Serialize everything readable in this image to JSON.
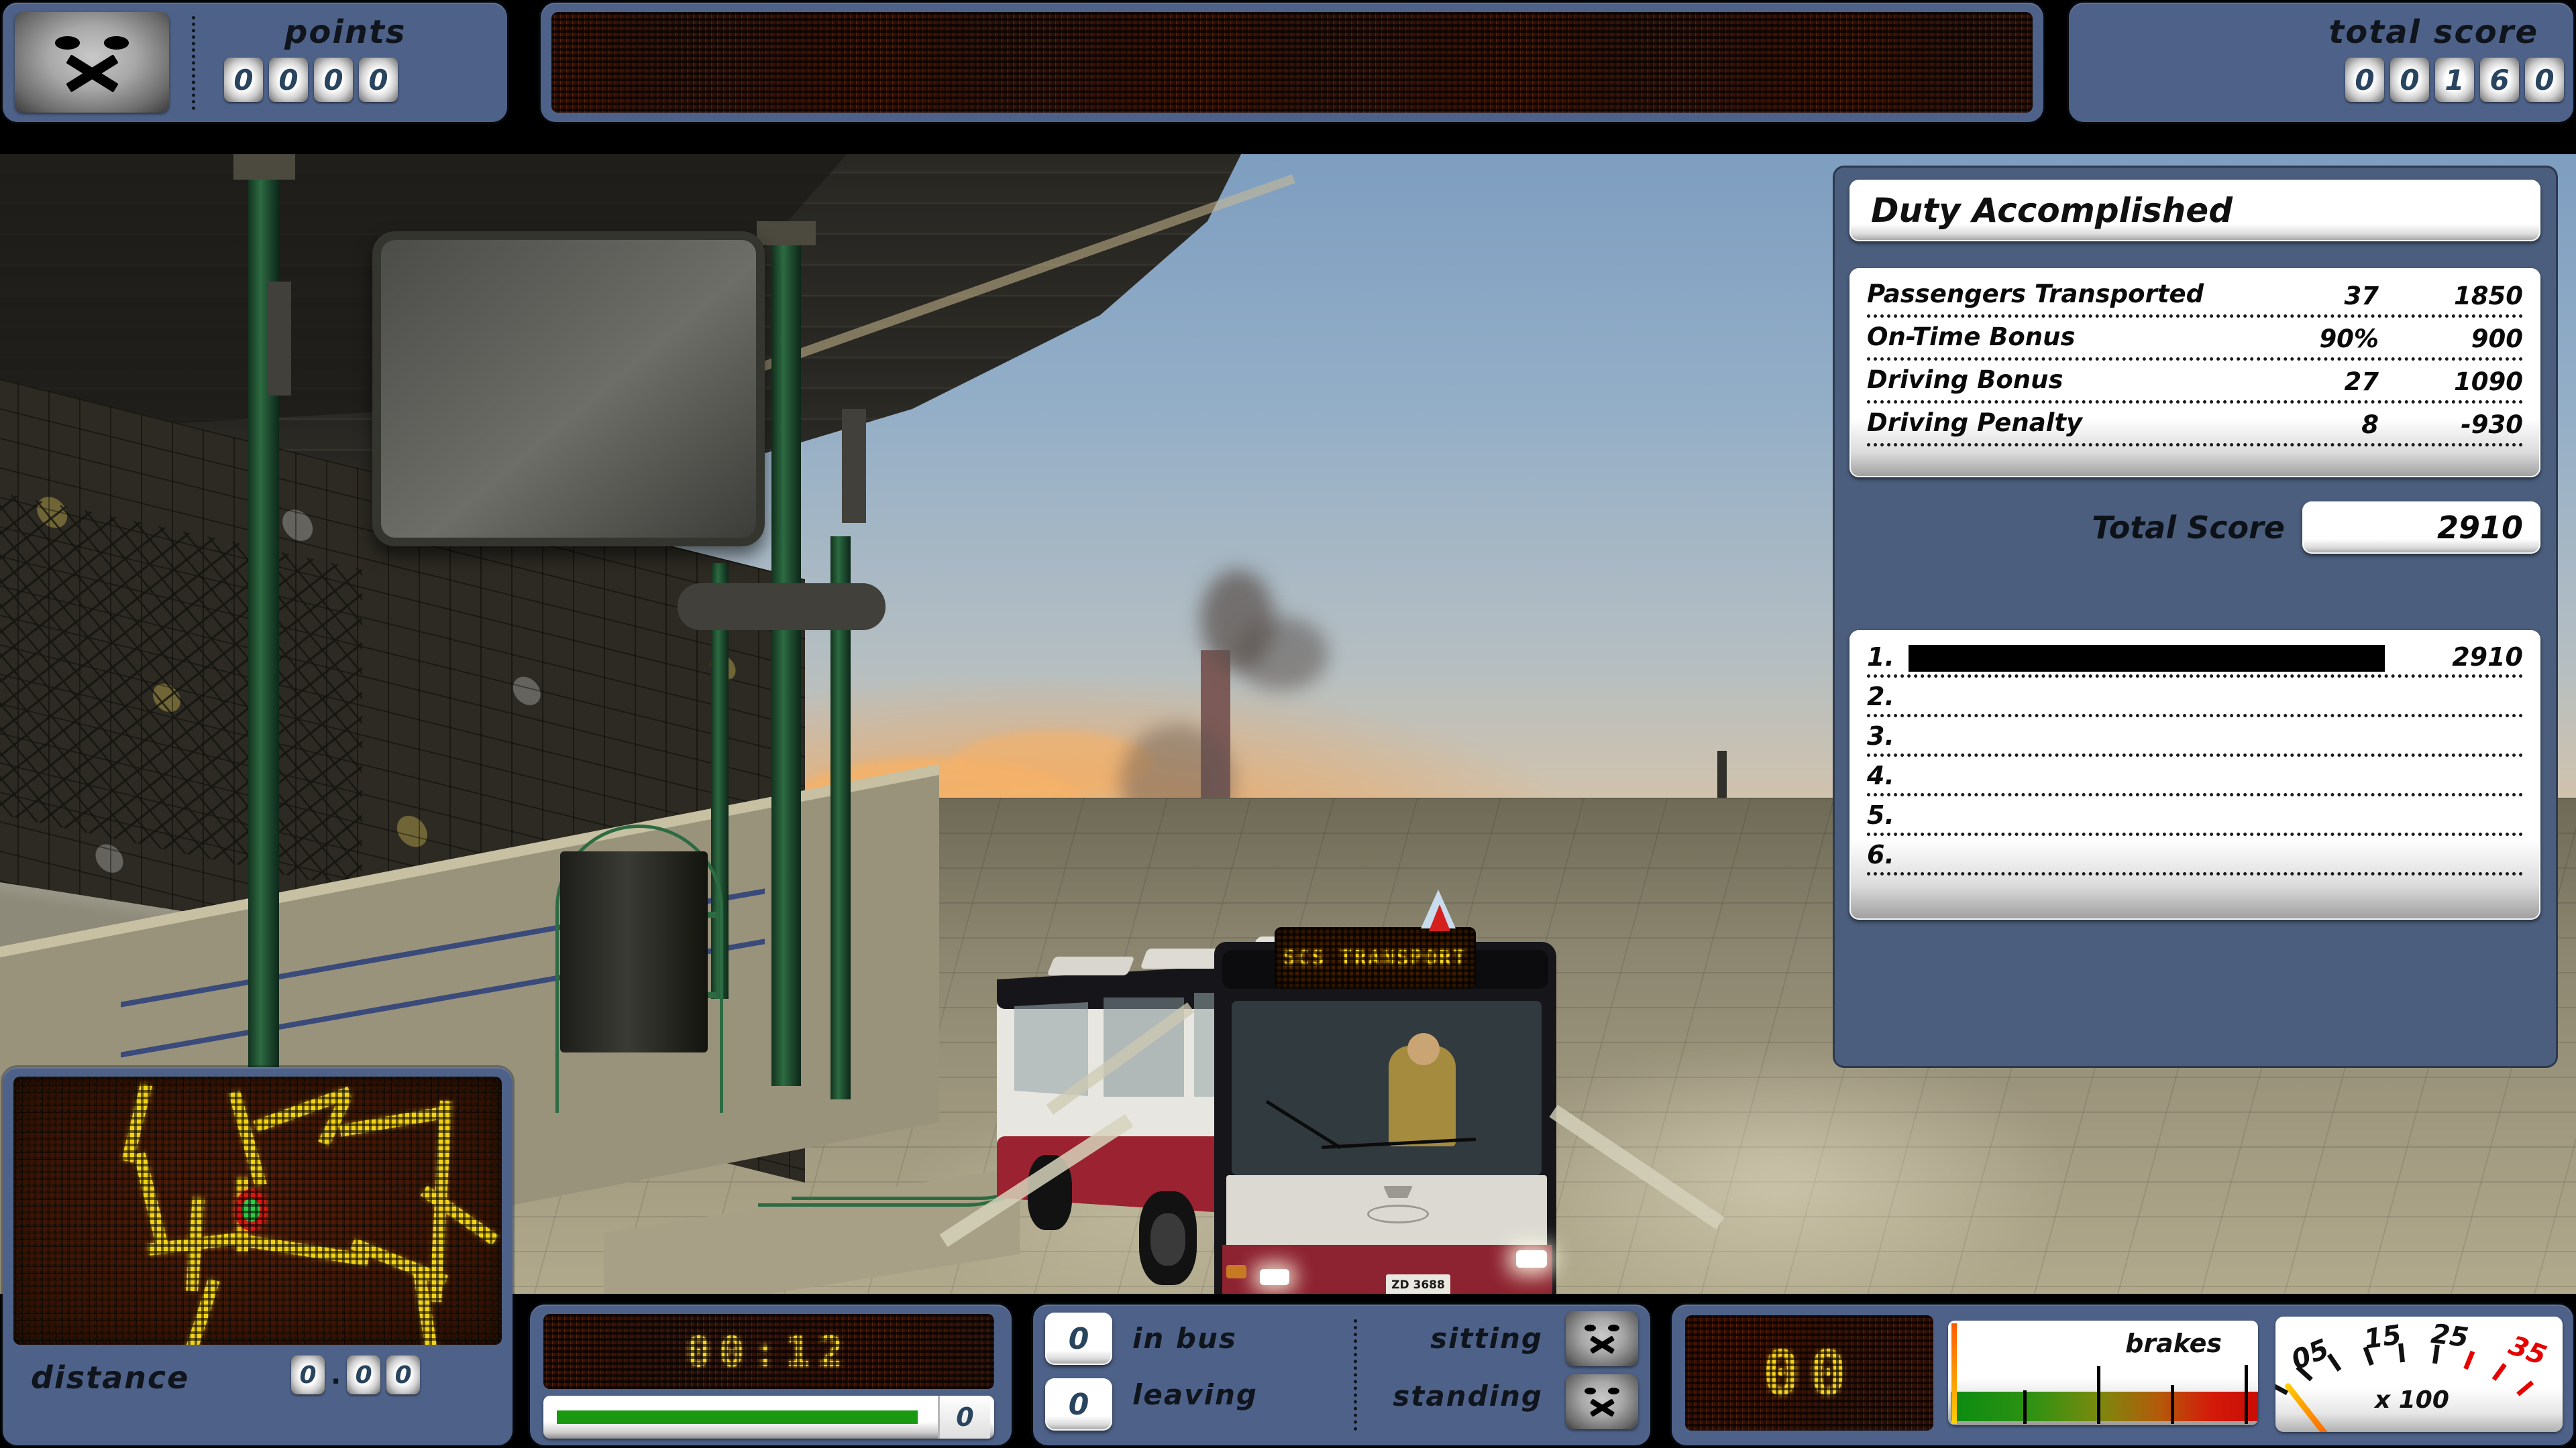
{
  "hud": {
    "mood_icon": "sad-face-icon",
    "points_label": "points",
    "points_digits": [
      "0",
      "0",
      "0",
      "0"
    ],
    "total_score_label": "total score",
    "total_score_digits": [
      "0",
      "0",
      "1",
      "6",
      "0"
    ],
    "ticker_text": ""
  },
  "results": {
    "title": "Duty Accomplished",
    "rows": [
      {
        "label": "Passengers Transported",
        "qty": "37",
        "value": "1850"
      },
      {
        "label": "On-Time Bonus",
        "qty": "90%",
        "value": "900"
      },
      {
        "label": "Driving Bonus",
        "qty": "27",
        "value": "1090"
      },
      {
        "label": "Driving Penalty",
        "qty": "8",
        "value": "-930"
      }
    ],
    "total_label": "Total Score",
    "total_value": "2910",
    "highscores": [
      {
        "rank": "1.",
        "name": "",
        "redacted": true,
        "score": "2910"
      },
      {
        "rank": "2.",
        "name": "",
        "redacted": false,
        "score": ""
      },
      {
        "rank": "3.",
        "name": "",
        "redacted": false,
        "score": ""
      },
      {
        "rank": "4.",
        "name": "",
        "redacted": false,
        "score": ""
      },
      {
        "rank": "5.",
        "name": "",
        "redacted": false,
        "score": ""
      },
      {
        "rank": "6.",
        "name": "",
        "redacted": false,
        "score": ""
      }
    ]
  },
  "minimap": {
    "distance_label": "distance",
    "distance_digits": [
      "0",
      "0",
      "0"
    ],
    "distance_separator": "."
  },
  "timer": {
    "led_text": "00:12",
    "bar_value": "0",
    "bar_percent": 88
  },
  "passengers": {
    "in_bus_count": "0",
    "in_bus_label": "in bus",
    "leaving_count": "0",
    "leaving_label": "leaving",
    "sitting_label": "sitting",
    "standing_label": "standing",
    "sitting_icon": "sad-face-icon",
    "standing_icon": "sad-face-icon"
  },
  "doors": {
    "led_text": "00"
  },
  "brakes": {
    "label": "brakes",
    "level_percent": 2
  },
  "tachometer": {
    "ticks": [
      "05",
      "15",
      "25",
      "35"
    ],
    "multiplier": "x 100",
    "redline_tick": "35",
    "needle_value": 0
  },
  "scene": {
    "bus_destination_sign": "SCS TRANSPORT",
    "bus_license_plate": "ZD 3688"
  },
  "colors": {
    "panel_blue": "#4e6289",
    "results_blue": "#4b5e7d",
    "digit_ink": "#28445e",
    "led_amber": "#ffd21e",
    "bar_green": "#18990f",
    "redline_red": "#e60000"
  }
}
